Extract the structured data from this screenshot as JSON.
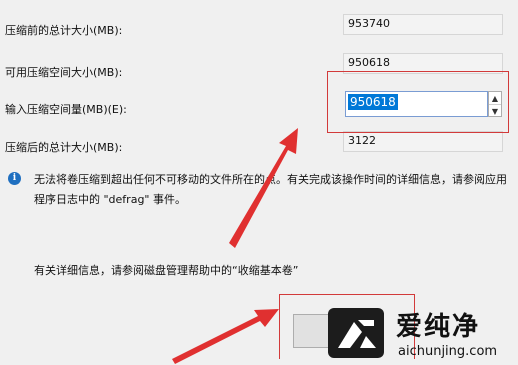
{
  "fields": [
    {
      "label": "压缩前的总计大小(MB):",
      "value": "953740"
    },
    {
      "label": "可用压缩空间大小(MB):",
      "value": "950618"
    },
    {
      "label": "输入压缩空间量(MB)(E):",
      "value": "950618"
    },
    {
      "label": "压缩后的总计大小(MB):",
      "value": "3122"
    }
  ],
  "info": {
    "icon": "info-icon",
    "text": "无法将卷压缩到超出任何不可移动的文件所在的点。有关完成该操作时间的详细信息，请参阅应用程序日志中的 \"defrag\" 事件。"
  },
  "help": {
    "text": "有关详细信息，请参阅磁盘管理帮助中的“收缩基本卷”"
  },
  "watermark": {
    "title": "爱纯净",
    "url": "aichunjing.com"
  },
  "colors": {
    "highlight": "#d23a3a",
    "selection": "#0078d7",
    "info": "#1f6fc0"
  }
}
